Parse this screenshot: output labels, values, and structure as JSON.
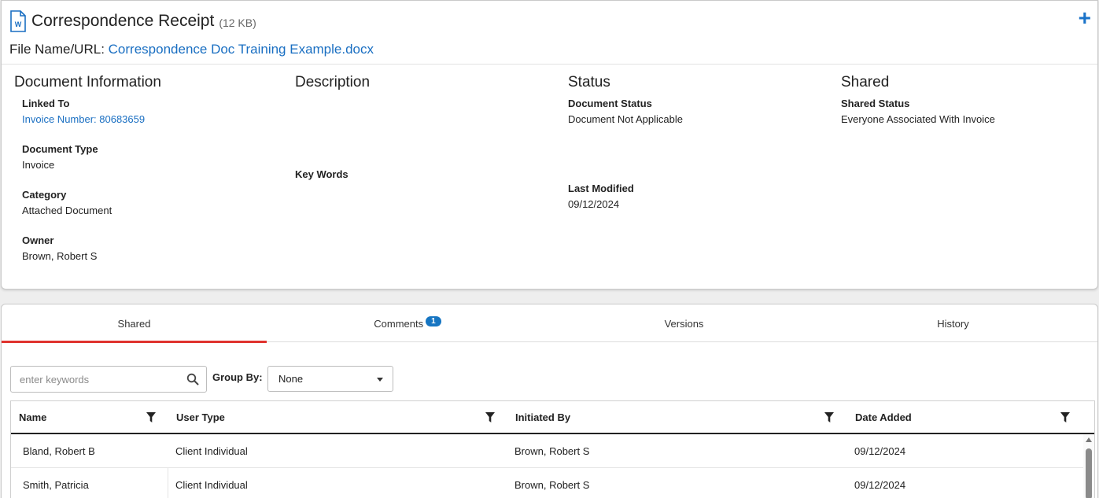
{
  "header": {
    "title": "Correspondence Receipt",
    "size": "(12 KB)",
    "add_label": "+",
    "file_label": "File Name/URL:",
    "file_name": "Correspondence Doc Training Example.docx"
  },
  "doc_info": {
    "heading": "Document Information",
    "linked_to_label": "Linked To",
    "linked_to_value": "Invoice Number: 80683659",
    "doc_type_label": "Document Type",
    "doc_type_value": "Invoice",
    "category_label": "Category",
    "category_value": "Attached Document",
    "owner_label": "Owner",
    "owner_value": "Brown, Robert S"
  },
  "description": {
    "heading": "Description",
    "keywords_label": "Key Words"
  },
  "status": {
    "heading": "Status",
    "doc_status_label": "Document Status",
    "doc_status_value": "Document Not Applicable",
    "last_modified_label": "Last Modified",
    "last_modified_value": "09/12/2024"
  },
  "shared": {
    "heading": "Shared",
    "status_label": "Shared Status",
    "status_value": "Everyone Associated With Invoice"
  },
  "tabs": [
    {
      "label": "Shared"
    },
    {
      "label": "Comments",
      "badge": "1"
    },
    {
      "label": "Versions"
    },
    {
      "label": "History"
    }
  ],
  "toolbar": {
    "search_placeholder": "enter keywords",
    "groupby_label": "Group By:",
    "groupby_value": "None"
  },
  "table": {
    "columns": [
      "Name",
      "User Type",
      "Initiated By",
      "Date Added"
    ],
    "rows": [
      [
        "Bland, Robert B",
        "Client Individual",
        "Brown, Robert S",
        "09/12/2024"
      ],
      [
        "Smith, Patricia",
        "Client Individual",
        "Brown, Robert S",
        "09/12/2024"
      ]
    ]
  },
  "colors": {
    "link": "#1a6fc2",
    "accent": "#1a73c9",
    "active_tab": "#e0332e",
    "badge": "#1675c2"
  },
  "icons": {
    "file": "word-doc-icon",
    "add": "plus-icon",
    "search": "search-icon",
    "filter": "filter-icon",
    "dropdown": "chevron-down-icon"
  }
}
